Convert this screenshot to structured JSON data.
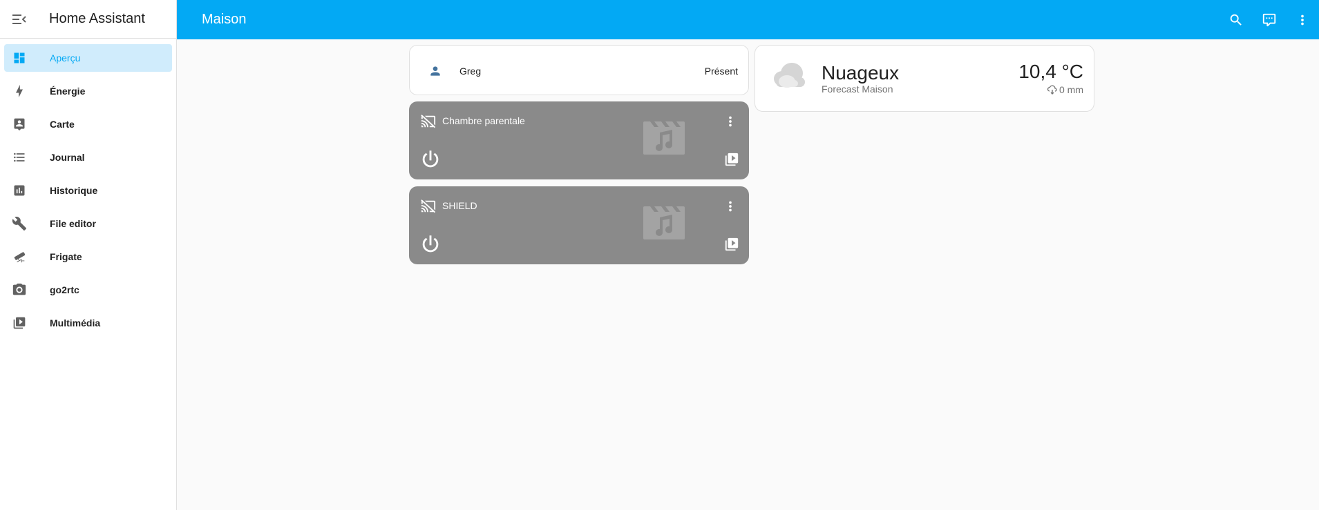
{
  "app": {
    "title": "Home Assistant"
  },
  "sidebar": {
    "items": [
      {
        "label": "Aperçu",
        "icon": "dashboard-icon",
        "active": true
      },
      {
        "label": "Énergie",
        "icon": "lightning-icon"
      },
      {
        "label": "Carte",
        "icon": "map-account-icon"
      },
      {
        "label": "Journal",
        "icon": "list-icon"
      },
      {
        "label": "Historique",
        "icon": "chart-bar-icon"
      },
      {
        "label": "File editor",
        "icon": "wrench-icon"
      },
      {
        "label": "Frigate",
        "icon": "cctv-icon"
      },
      {
        "label": "go2rtc",
        "icon": "camera-icon"
      },
      {
        "label": "Multimédia",
        "icon": "play-box-multiple-icon"
      }
    ]
  },
  "header": {
    "title": "Maison"
  },
  "person_card": {
    "name": "Greg",
    "state": "Présent"
  },
  "weather_card": {
    "condition": "Nuageux",
    "location": "Forecast Maison",
    "temperature": "10,4 °C",
    "precipitation": "0 mm"
  },
  "media_cards": [
    {
      "name": "Chambre parentale"
    },
    {
      "name": "SHIELD"
    }
  ],
  "colors": {
    "accent": "#03a9f4",
    "active_bg": "#d0ecfc",
    "media_card_bg": "#8a8a8a",
    "person_icon": "#44739e"
  }
}
